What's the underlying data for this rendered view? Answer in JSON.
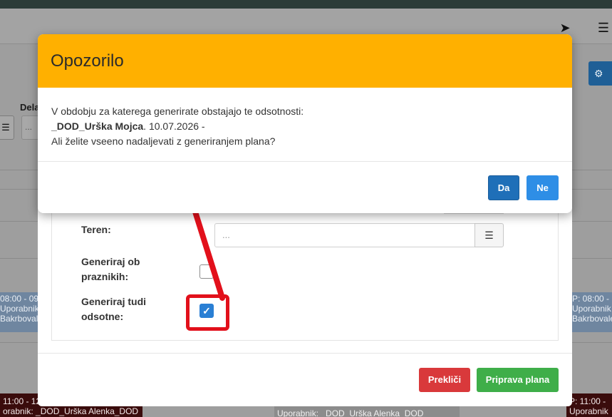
{
  "background": {
    "label_dela": "Dela",
    "input_placeholder": "...",
    "events_left": [
      "08:00 - 09",
      "Uporabnik: _D",
      "Bakrbovalec"
    ],
    "events_right": [
      "P: 08:00 -",
      "Uporabnik",
      "Bakrbovalec"
    ],
    "bottom_left": [
      "11:00 - 12",
      "orabnik: _DOD_Urška Alenka_DOD"
    ],
    "bottom_mid": "Uporabnik: _DOD_Urška Alenka_DOD",
    "bottom_right": [
      "P: 11:00 -",
      "Uporabnik"
    ]
  },
  "form": {
    "teren_label": "Teren:",
    "teren_placeholder": "...",
    "praznik_label": "Generiraj ob praznikih:",
    "odsotne_label": "Generiraj tudi odsotne:",
    "praznik_checked": false,
    "odsotne_checked": true,
    "cancel_label": "Prekliči",
    "prepare_label": "Priprava plana"
  },
  "modal": {
    "title": "Opozorilo",
    "line1": "V obdobju za katerega generirate obstajajo te odsotnosti:",
    "absence_name": "_DOD_Urška Mojca",
    "absence_date": ". 10.07.2026 -",
    "line3": "Ali želite vseeno nadaljevati z generiranjem plana?",
    "yes_label": "Da",
    "no_label": "Ne"
  },
  "colors": {
    "modal_header": "#ffb000",
    "annotation": "#e2101b",
    "btn_yes": "#1f6fb8",
    "btn_no": "#2e8ee6"
  }
}
